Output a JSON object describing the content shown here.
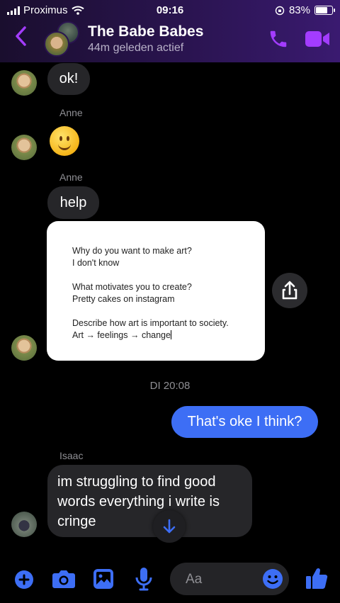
{
  "status_bar": {
    "carrier": "Proximus",
    "time": "09:16",
    "battery": "83%",
    "battery_level": 0.83
  },
  "header": {
    "title": "The Babe Babes",
    "subtitle": "44m geleden actief"
  },
  "messages": {
    "msg1": "ok!",
    "sender_anne_1": "Anne",
    "emoji": "🙂",
    "sender_anne_2": "Anne",
    "msg2": "help",
    "image_lines": [
      "Why do you want to make art?",
      "I don't know",
      "What motivates you to create?",
      "Pretty cakes on instagram",
      "Describe how art is important to society.",
      "Art → feelings → change"
    ],
    "timestamp": "DI 20:08",
    "mine": "That's oke I think?",
    "sender_isaac": "Isaac",
    "msg_isaac": "im struggling to find good words everything i write is cringe"
  },
  "composer": {
    "placeholder": "Aa"
  },
  "colors": {
    "accent": "#a33cff",
    "blue": "#3d6ef5",
    "bubble": "#262629"
  },
  "icons": [
    "back-icon",
    "phone-icon",
    "video-icon",
    "share-icon",
    "arrow-down-icon",
    "plus-icon",
    "camera-icon",
    "image-icon",
    "mic-icon",
    "emoji-icon",
    "like-icon"
  ]
}
